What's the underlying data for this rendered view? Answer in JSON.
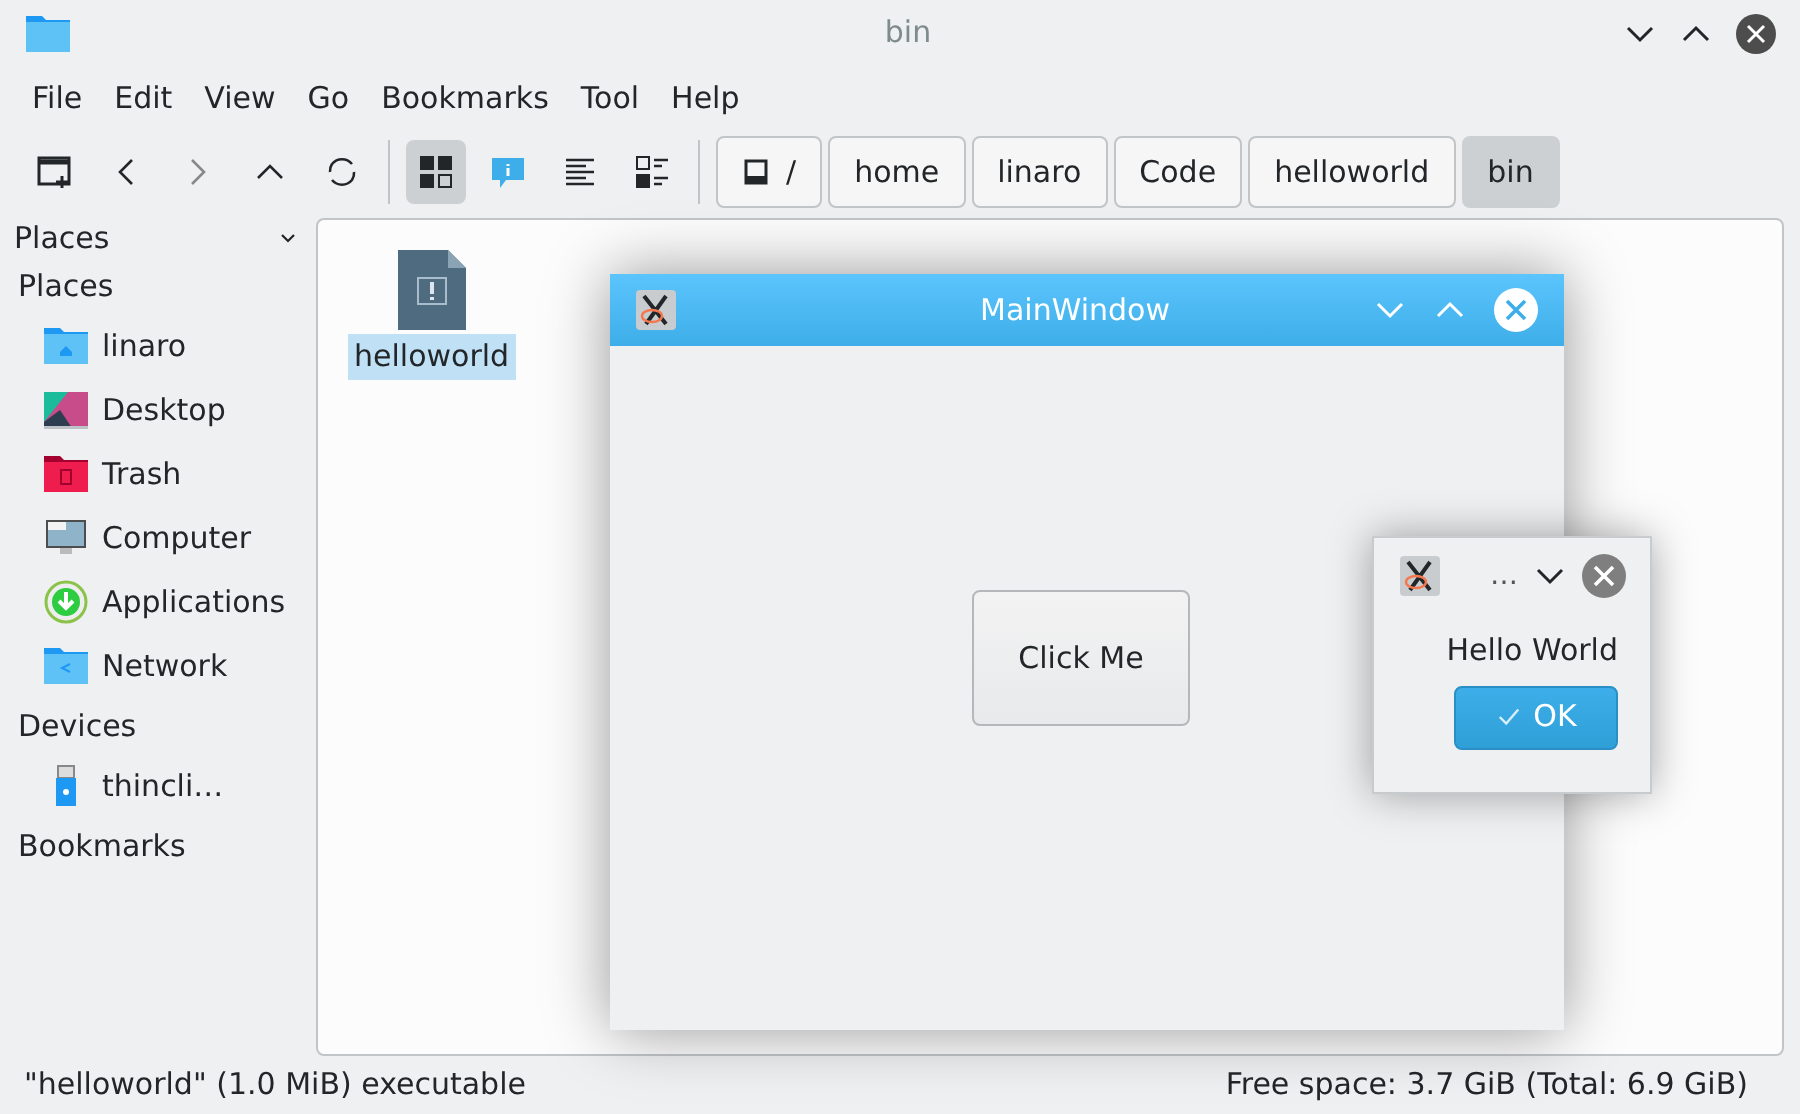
{
  "window": {
    "title": "bin"
  },
  "menu": [
    "File",
    "Edit",
    "View",
    "Go",
    "Bookmarks",
    "Tool",
    "Help"
  ],
  "toolbar": [
    {
      "kind": "new-tab",
      "selected": false
    },
    {
      "kind": "back",
      "selected": false
    },
    {
      "kind": "forward",
      "selected": false
    },
    {
      "kind": "up",
      "selected": false
    },
    {
      "kind": "reload",
      "selected": false
    },
    {
      "kind": "icons-view",
      "selected": true
    },
    {
      "kind": "info",
      "selected": false
    },
    {
      "kind": "details-view",
      "selected": false
    },
    {
      "kind": "compact-view",
      "selected": false
    }
  ],
  "breadcrumb": [
    {
      "label": "/",
      "kind": "root",
      "selected": false
    },
    {
      "label": "home",
      "kind": "folder",
      "selected": false
    },
    {
      "label": "linaro",
      "kind": "folder",
      "selected": false
    },
    {
      "label": "Code",
      "kind": "folder",
      "selected": false
    },
    {
      "label": "helloworld",
      "kind": "folder",
      "selected": false
    },
    {
      "label": "bin",
      "kind": "folder",
      "selected": true
    }
  ],
  "sidebar": {
    "header": "Places",
    "sections": [
      {
        "title": "Places",
        "items": [
          {
            "label": "linaro",
            "kind": "home"
          },
          {
            "label": "Desktop",
            "kind": "desktop"
          },
          {
            "label": "Trash",
            "kind": "trash"
          },
          {
            "label": "Computer",
            "kind": "computer"
          },
          {
            "label": "Applications",
            "kind": "applications"
          },
          {
            "label": "Network",
            "kind": "network"
          }
        ]
      },
      {
        "title": "Devices",
        "items": [
          {
            "label": "thincli…",
            "kind": "usb"
          }
        ]
      },
      {
        "title": "Bookmarks"
      }
    ]
  },
  "files": [
    {
      "name": "helloworld",
      "selected": true
    }
  ],
  "status_bar": {
    "left": "\"helloworld\" (1.0 MiB) executable",
    "right": "Free space: 3.7 GiB (Total: 6.9 GiB)"
  },
  "main_window": {
    "title": "MainWindow",
    "button": "Click Me"
  },
  "message_box": {
    "title": "…",
    "text": "Hello World",
    "button": "OK"
  }
}
